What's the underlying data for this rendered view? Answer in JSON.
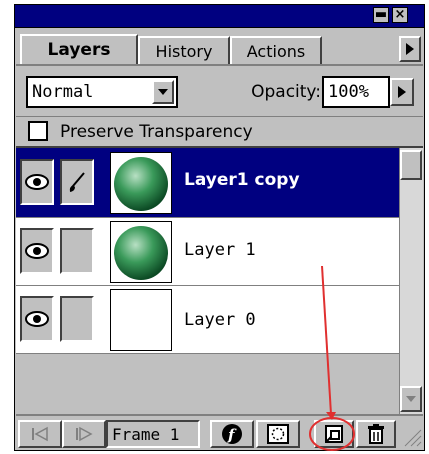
{
  "tabs": [
    {
      "label": "Layers"
    },
    {
      "label": "History"
    },
    {
      "label": "Actions"
    }
  ],
  "blend_mode": {
    "value": "Normal"
  },
  "opacity": {
    "label": "Opacity:",
    "value": "100%"
  },
  "preserve_transparency": {
    "label": "Preserve Transparency",
    "checked": false
  },
  "layers": [
    {
      "name": "Layer1 copy",
      "selected": true,
      "visible": true,
      "brush": true,
      "thumbnail": "green-sphere"
    },
    {
      "name": "Layer 1",
      "selected": false,
      "visible": true,
      "brush": false,
      "thumbnail": "green-sphere"
    },
    {
      "name": "Layer 0",
      "selected": false,
      "visible": true,
      "brush": false,
      "thumbnail": "blank"
    }
  ],
  "footer": {
    "frame_label": "Frame 1"
  },
  "colors": {
    "title_bar": "#000080",
    "selected_row": "#000080",
    "panel": "#c0c0c0",
    "annotation": "#e03030"
  }
}
